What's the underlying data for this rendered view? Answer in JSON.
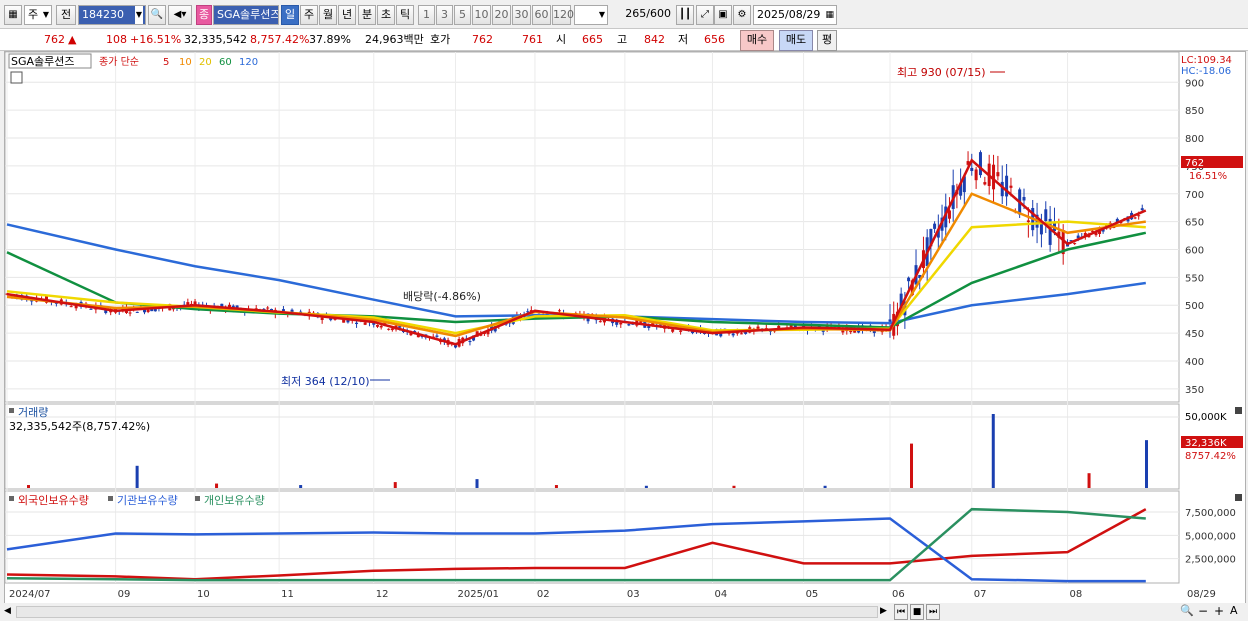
{
  "toolbar": {
    "grid_icon": "grid-icon",
    "main_select": "주",
    "prev_label": "전",
    "code": "184230",
    "name": "SGA솔루션즈",
    "tab_day": "일",
    "tab_week": "주",
    "tab_month": "월",
    "tab_year": "년",
    "tab_minute": "분",
    "tab_second": "초",
    "tab_tick": "틱",
    "periods": [
      "1",
      "3",
      "5",
      "10",
      "20",
      "30",
      "60",
      "120"
    ],
    "count": "265",
    "count_total": "/600",
    "date": "2025/08/29",
    "jung_label": "종"
  },
  "quote": {
    "price": "762",
    "arrow": "▲",
    "change": "108",
    "change_pct": "+16.51%",
    "volume": "32,335,542",
    "volume_pct": "8,757.42%",
    "turnover": "37.89%",
    "amount": "24,963백만",
    "hoga_label": "호가",
    "ask": "762",
    "bid": "761",
    "open_label": "시",
    "open": "665",
    "high_label": "고",
    "high": "842",
    "low_label": "저",
    "low": "656",
    "buy_button": "매수",
    "sell_button": "매도",
    "pyeong_button": "평"
  },
  "price_panel": {
    "title": "SGA솔루션즈",
    "ma_label": "종가 단순",
    "ma_periods": [
      "5",
      "10",
      "20",
      "60",
      "120"
    ],
    "lc": "LC:109.34",
    "hc": "HC:-18.06",
    "current": "762",
    "current_pct": "16.51%",
    "annot_high": "최고 930 (07/15)",
    "annot_low": "최저 364 (12/10)",
    "annot_div": "배당락(-4.86%)"
  },
  "volume_panel": {
    "title": "거래량",
    "value": "32,335,542주(8,757.42%)",
    "axis_top": "50,000K",
    "current": "32,336K",
    "current_pct": "8757.42%"
  },
  "holding_panel": {
    "legend": [
      "외국인보유수량",
      "기관보유수량",
      "개인보유수량"
    ]
  },
  "xaxis": [
    "2024/07",
    "09",
    "10",
    "11",
    "12",
    "2025/01",
    "02",
    "03",
    "04",
    "05",
    "06",
    "07",
    "08"
  ],
  "xaxis_end": "08/29",
  "colors": {
    "ma5": "#d01010",
    "ma10": "#f08a00",
    "ma20": "#f0d800",
    "ma60": "#109040",
    "ma120": "#2b6ad8",
    "foreign": "#d01010",
    "institution": "#2b5fd8",
    "individual": "#2a9060"
  },
  "chart_data": [
    {
      "type": "line",
      "title": "SGA솔루션즈 종가 단순",
      "xlabel": "",
      "ylabel": "",
      "ylim": [
        330,
        940
      ],
      "yticks": [
        350,
        400,
        450,
        500,
        550,
        600,
        650,
        700,
        750,
        800,
        850,
        900
      ],
      "categories": [
        "2024/07",
        "09",
        "10",
        "11",
        "12",
        "2025/01",
        "02",
        "03",
        "04",
        "05",
        "06",
        "07",
        "08",
        "08/29"
      ],
      "series": [
        {
          "name": "5",
          "values": [
            520,
            490,
            500,
            488,
            470,
            430,
            490,
            470,
            450,
            460,
            456,
            760,
            610,
            670
          ]
        },
        {
          "name": "10",
          "values": [
            515,
            495,
            498,
            488,
            474,
            445,
            488,
            478,
            452,
            458,
            455,
            700,
            630,
            650
          ]
        },
        {
          "name": "20",
          "values": [
            525,
            505,
            497,
            487,
            478,
            450,
            480,
            482,
            455,
            456,
            458,
            640,
            650,
            640
          ]
        },
        {
          "name": "60",
          "values": [
            595,
            505,
            493,
            485,
            480,
            470,
            476,
            480,
            470,
            465,
            460,
            540,
            600,
            630
          ]
        },
        {
          "name": "120",
          "values": [
            645,
            600,
            570,
            545,
            510,
            480,
            482,
            480,
            475,
            470,
            468,
            500,
            520,
            540
          ]
        }
      ]
    },
    {
      "type": "bar",
      "title": "거래량",
      "ylim": [
        0,
        50000
      ],
      "categories": [
        "2024/07",
        "09",
        "10",
        "11",
        "12",
        "2025/01",
        "02",
        "03",
        "04",
        "05",
        "06",
        "07",
        "08",
        "08/29"
      ],
      "series": [
        {
          "name": "거래량",
          "values": [
            2000,
            15000,
            3000,
            2000,
            4000,
            6000,
            2000,
            1500,
            1500,
            1500,
            30000,
            50000,
            10000,
            32336
          ]
        }
      ]
    },
    {
      "type": "line",
      "title": "보유수량",
      "ylim": [
        0,
        9000000
      ],
      "yticks": [
        2500000,
        5000000,
        7500000
      ],
      "categories": [
        "2024/07",
        "09",
        "10",
        "11",
        "12",
        "2025/01",
        "02",
        "03",
        "04",
        "05",
        "06",
        "07",
        "08",
        "08/29"
      ],
      "series": [
        {
          "name": "외국인보유수량",
          "values": [
            800000,
            600000,
            300000,
            700000,
            1200000,
            1400000,
            1500000,
            1500000,
            4200000,
            2000000,
            2000000,
            2800000,
            3200000,
            7800000
          ]
        },
        {
          "name": "기관보유수량",
          "values": [
            3500000,
            5200000,
            5100000,
            5200000,
            5300000,
            5200000,
            5200000,
            5500000,
            6200000,
            6500000,
            6800000,
            300000,
            100000,
            100000
          ]
        },
        {
          "name": "개인보유수량",
          "values": [
            400000,
            300000,
            200000,
            200000,
            200000,
            200000,
            200000,
            200000,
            200000,
            200000,
            200000,
            7800000,
            7500000,
            6800000
          ]
        }
      ]
    }
  ]
}
